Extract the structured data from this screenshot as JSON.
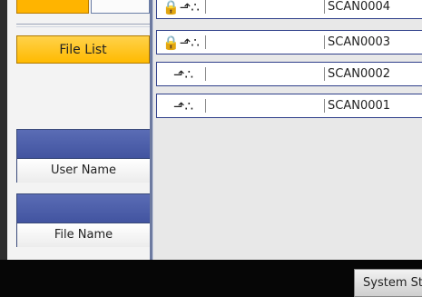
{
  "left_panel": {
    "top_tab_label": "",
    "file_list_label": "File List",
    "user_name_label": "User Name",
    "file_name_label": "File Name"
  },
  "files": [
    {
      "name": "SCAN0004",
      "locked": true
    },
    {
      "name": "SCAN0003",
      "locked": true
    },
    {
      "name": "SCAN0002",
      "locked": false
    },
    {
      "name": "SCAN0001",
      "locked": false
    }
  ],
  "bottom_bar": {
    "status_label": "System Status"
  },
  "colors": {
    "accent": "#ffba00",
    "field_blue": "#4a5ca8",
    "row_border": "#2f3f8a"
  }
}
